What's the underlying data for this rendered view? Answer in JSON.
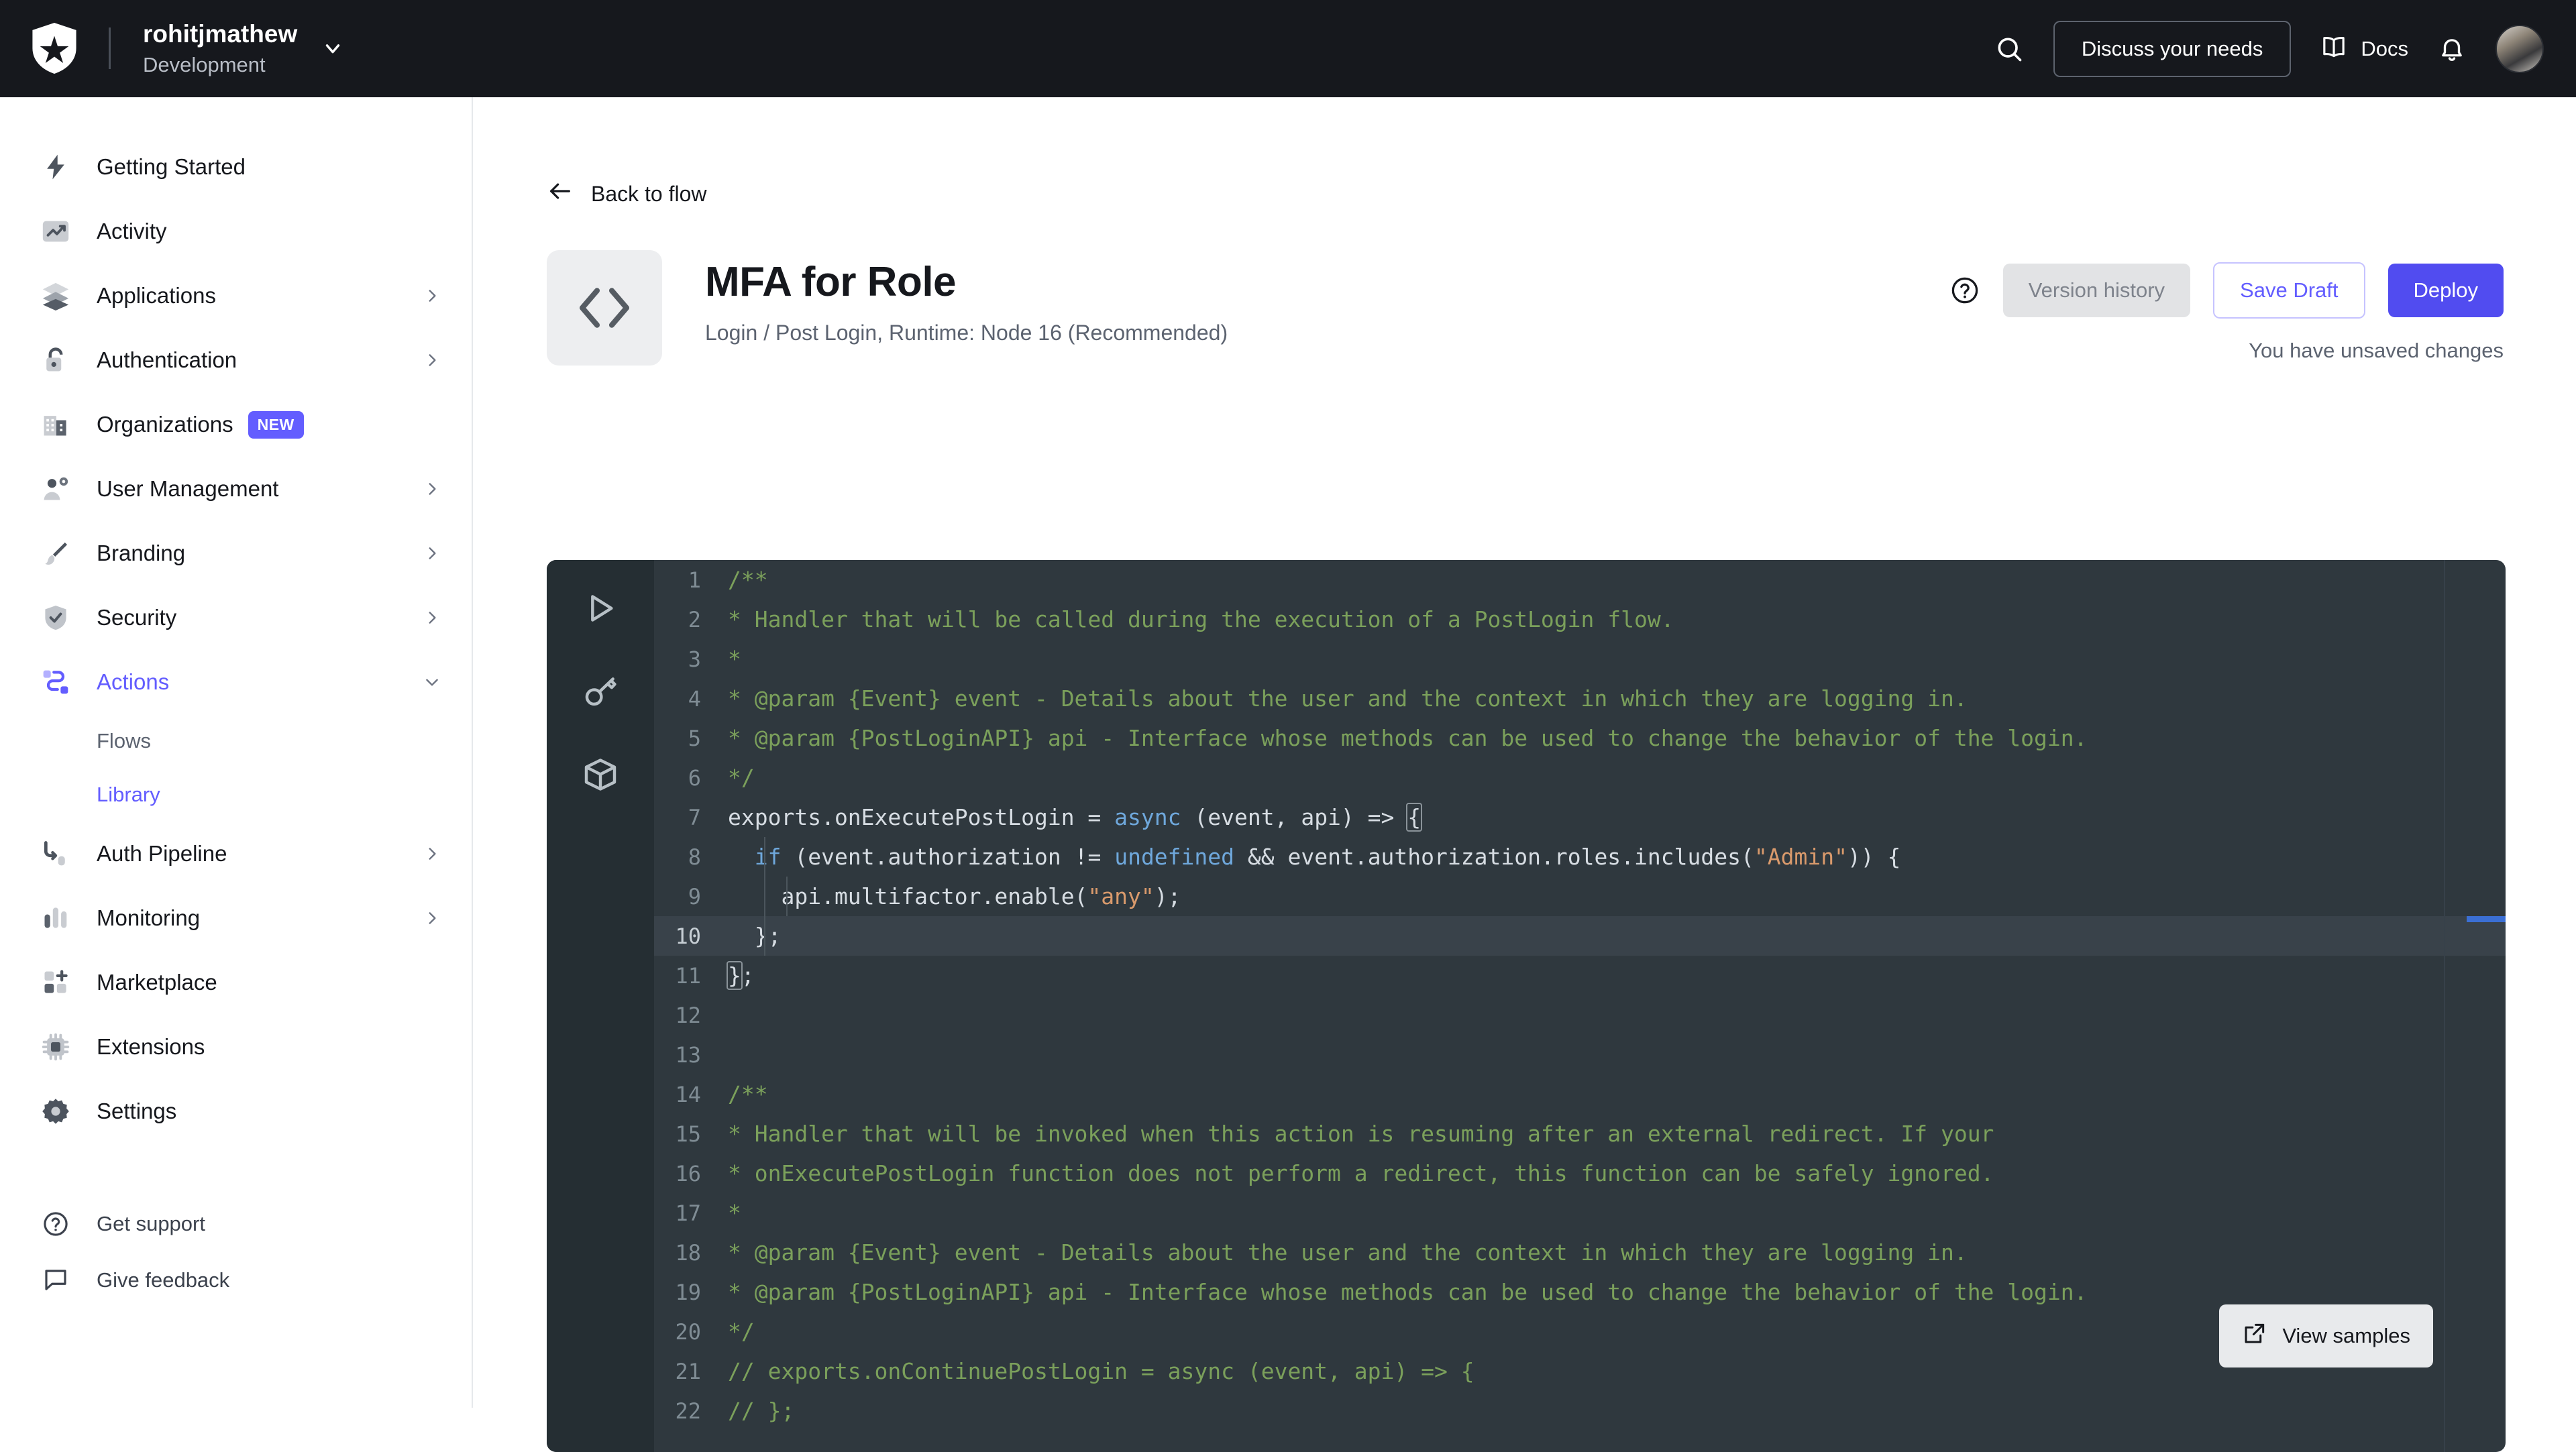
{
  "topbar": {
    "logo_icon": "auth0-shield-icon",
    "tenant_name": "rohitjmathew",
    "tenant_env": "Development",
    "tenant_chevron_icon": "chevron-down-icon",
    "search_icon": "search-icon",
    "discuss_label": "Discuss your needs",
    "docs_icon": "book-icon",
    "docs_label": "Docs",
    "notifications_icon": "bell-icon",
    "avatar_label": "avatar"
  },
  "sidebar": {
    "items": [
      {
        "label": "Getting Started",
        "icon": "lightning-bolt-icon",
        "expandable": false,
        "active": false
      },
      {
        "label": "Activity",
        "icon": "trending-up-icon",
        "expandable": false,
        "active": false
      },
      {
        "label": "Applications",
        "icon": "layers-icon",
        "expandable": true,
        "active": false
      },
      {
        "label": "Authentication",
        "icon": "unlocked-padlock-icon",
        "expandable": true,
        "active": false
      },
      {
        "label": "Organizations",
        "icon": "building-icon",
        "expandable": false,
        "active": false,
        "badge": "NEW"
      },
      {
        "label": "User Management",
        "icon": "user-gear-icon",
        "expandable": true,
        "active": false
      },
      {
        "label": "Branding",
        "icon": "paintbrush-icon",
        "expandable": true,
        "active": false
      },
      {
        "label": "Security",
        "icon": "shield-check-icon",
        "expandable": true,
        "active": false
      },
      {
        "label": "Actions",
        "icon": "actions-flow-icon",
        "expandable": true,
        "active": true,
        "expanded": true
      },
      {
        "label": "Auth Pipeline",
        "icon": "pipeline-icon",
        "expandable": true,
        "active": false
      },
      {
        "label": "Monitoring",
        "icon": "bar-chart-icon",
        "expandable": true,
        "active": false
      },
      {
        "label": "Marketplace",
        "icon": "grid-plus-icon",
        "expandable": false,
        "active": false
      },
      {
        "label": "Extensions",
        "icon": "chip-icon",
        "expandable": false,
        "active": false
      },
      {
        "label": "Settings",
        "icon": "gear-icon",
        "expandable": false,
        "active": false
      }
    ],
    "actions_subitems": [
      {
        "label": "Flows",
        "active": false
      },
      {
        "label": "Library",
        "active": true
      }
    ],
    "bottom_items": [
      {
        "label": "Get support",
        "icon": "question-circle-icon"
      },
      {
        "label": "Give feedback",
        "icon": "speech-bubble-icon"
      }
    ]
  },
  "main": {
    "back_label": "Back to flow",
    "back_icon": "arrow-left-icon",
    "badge_icon": "code-brackets-icon",
    "title": "MFA for Role",
    "subtitle": "Login / Post Login, Runtime: Node 16 (Recommended)",
    "help_icon": "question-circle-icon",
    "version_history_label": "Version history",
    "save_draft_label": "Save Draft",
    "deploy_label": "Deploy",
    "unsaved_label": "You have unsaved changes"
  },
  "editor": {
    "rail_icons": [
      "play-run-icon",
      "key-secrets-icon",
      "box-modules-icon"
    ],
    "samples_label": "View samples",
    "samples_icon": "external-link-icon",
    "current_line": 10,
    "colors": {
      "background": "#2f383e",
      "rail": "#252e33",
      "comment": "#7ba05b",
      "keyword": "#6fa8dc",
      "string": "#d99a6c",
      "plain": "#d7dde3",
      "current_line_bg": "#39424a",
      "accent_purple": "#635dff",
      "deploy_purple": "#514cf0"
    },
    "lines": [
      {
        "n": 1,
        "tokens": [
          {
            "t": "/**",
            "c": "cm"
          }
        ]
      },
      {
        "n": 2,
        "tokens": [
          {
            "t": "* Handler that will be called during the execution of a PostLogin flow.",
            "c": "cm"
          }
        ]
      },
      {
        "n": 3,
        "tokens": [
          {
            "t": "*",
            "c": "cm"
          }
        ]
      },
      {
        "n": 4,
        "tokens": [
          {
            "t": "* @param {Event} event - Details about the user and the context in which they are logging in.",
            "c": "cm"
          }
        ]
      },
      {
        "n": 5,
        "tokens": [
          {
            "t": "* @param {PostLoginAPI} api - Interface whose methods can be used to change the behavior of the login.",
            "c": "cm"
          }
        ]
      },
      {
        "n": 6,
        "tokens": [
          {
            "t": "*/",
            "c": "cm"
          }
        ]
      },
      {
        "n": 7,
        "tokens": [
          {
            "t": "exports.onExecutePostLogin = ",
            "c": "pl"
          },
          {
            "t": "async",
            "c": "kw"
          },
          {
            "t": " (event, api) => ",
            "c": "pl"
          },
          {
            "t": "{",
            "c": "pl brk-box"
          }
        ]
      },
      {
        "n": 8,
        "tokens": [
          {
            "t": "  ",
            "c": "pl"
          },
          {
            "t": "if",
            "c": "kw"
          },
          {
            "t": " (event.authorization != ",
            "c": "pl"
          },
          {
            "t": "undefined",
            "c": "kw"
          },
          {
            "t": " && event.authorization.roles.includes(",
            "c": "pl"
          },
          {
            "t": "\"Admin\"",
            "c": "str"
          },
          {
            "t": ")) {",
            "c": "pl"
          }
        ]
      },
      {
        "n": 9,
        "tokens": [
          {
            "t": "    api.multifactor.enable(",
            "c": "pl"
          },
          {
            "t": "\"any\"",
            "c": "str"
          },
          {
            "t": ");",
            "c": "pl"
          }
        ]
      },
      {
        "n": 10,
        "tokens": [
          {
            "t": "  };",
            "c": "pl"
          }
        ]
      },
      {
        "n": 11,
        "tokens": [
          {
            "t": "}",
            "c": "pl brk-box"
          },
          {
            "t": ";",
            "c": "pl"
          }
        ]
      },
      {
        "n": 12,
        "tokens": [
          {
            "t": "",
            "c": "pl"
          }
        ]
      },
      {
        "n": 13,
        "tokens": [
          {
            "t": "",
            "c": "pl"
          }
        ]
      },
      {
        "n": 14,
        "tokens": [
          {
            "t": "/**",
            "c": "cm"
          }
        ]
      },
      {
        "n": 15,
        "tokens": [
          {
            "t": "* Handler that will be invoked when this action is resuming after an external redirect. If your",
            "c": "cm"
          }
        ]
      },
      {
        "n": 16,
        "tokens": [
          {
            "t": "* onExecutePostLogin function does not perform a redirect, this function can be safely ignored.",
            "c": "cm"
          }
        ]
      },
      {
        "n": 17,
        "tokens": [
          {
            "t": "*",
            "c": "cm"
          }
        ]
      },
      {
        "n": 18,
        "tokens": [
          {
            "t": "* @param {Event} event - Details about the user and the context in which they are logging in.",
            "c": "cm"
          }
        ]
      },
      {
        "n": 19,
        "tokens": [
          {
            "t": "* @param {PostLoginAPI} api - Interface whose methods can be used to change the behavior of the login.",
            "c": "cm"
          }
        ]
      },
      {
        "n": 20,
        "tokens": [
          {
            "t": "*/",
            "c": "cm"
          }
        ]
      },
      {
        "n": 21,
        "tokens": [
          {
            "t": "// exports.onContinuePostLogin = async (event, api) => {",
            "c": "cm"
          }
        ]
      },
      {
        "n": 22,
        "tokens": [
          {
            "t": "// };",
            "c": "cm"
          }
        ]
      }
    ]
  }
}
